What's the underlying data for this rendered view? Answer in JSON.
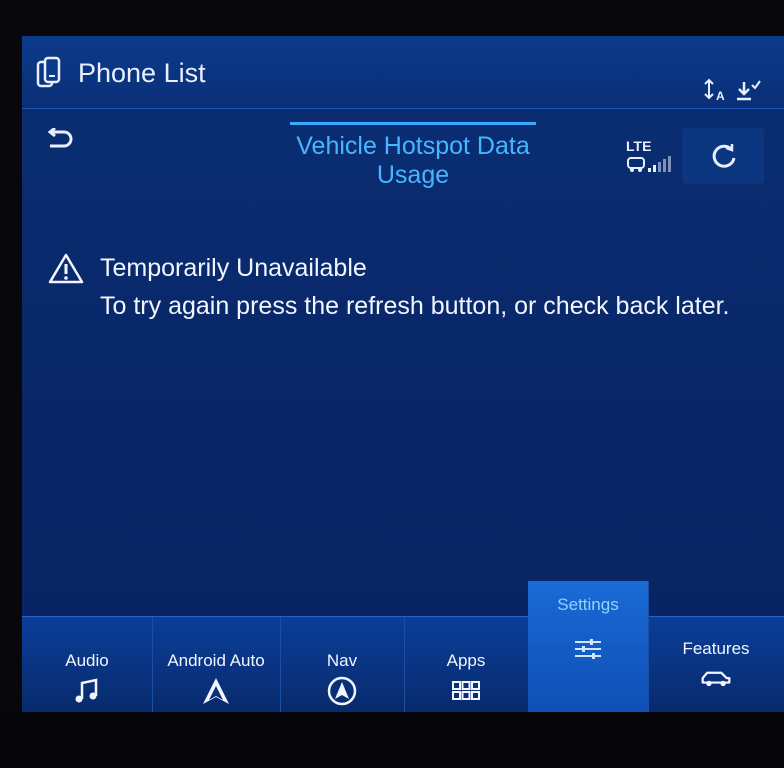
{
  "topbar": {
    "title": "Phone List",
    "icons": [
      "phone-icon",
      "sort-icon",
      "download-icon"
    ]
  },
  "header": {
    "title": "Vehicle Hotspot Data Usage",
    "signal_label": "LTE",
    "icons": [
      "back-icon",
      "lte-signal-icon",
      "refresh-icon"
    ]
  },
  "message": {
    "icon": "warning-icon",
    "title": "Temporarily Unavailable",
    "body": "To try again press the refresh button, or check back later."
  },
  "bottom_nav": {
    "items": [
      {
        "label": "Audio",
        "icon": "music-note-icon"
      },
      {
        "label": "Android Auto",
        "icon": "android-auto-icon"
      },
      {
        "label": "Nav",
        "icon": "navigation-icon"
      },
      {
        "label": "Apps",
        "icon": "apps-grid-icon"
      },
      {
        "label": "Settings",
        "icon": "settings-sliders-icon",
        "active": true
      },
      {
        "label": "Features",
        "icon": "vehicle-icon"
      }
    ]
  },
  "colors": {
    "accent": "#46b6ff",
    "background": "#0a2f74",
    "active_tab": "#1a6ad6"
  }
}
